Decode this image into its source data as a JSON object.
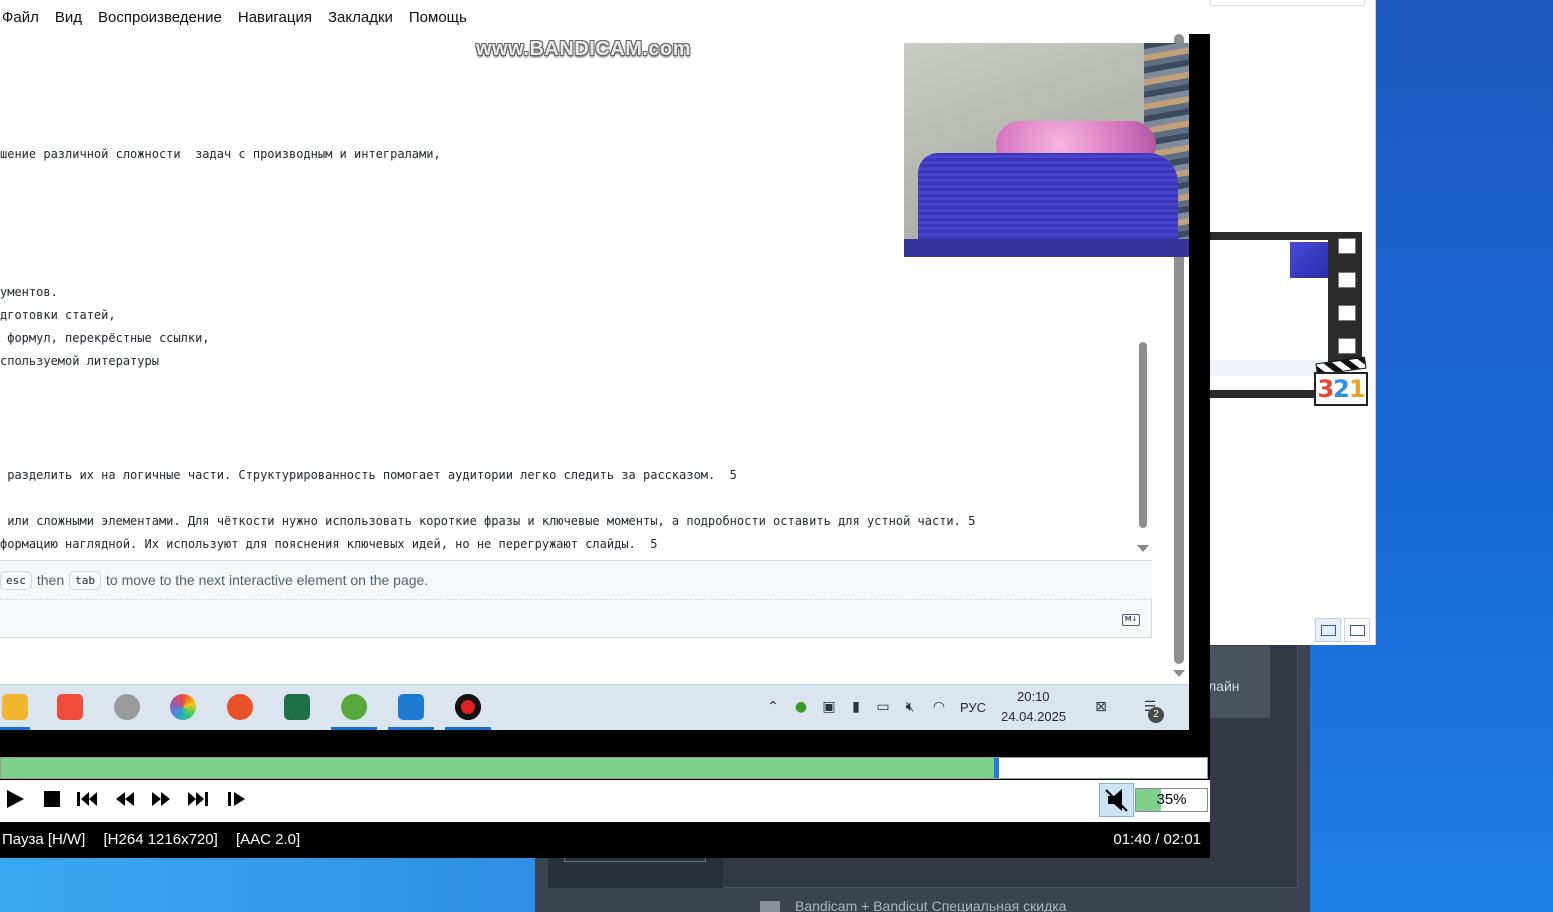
{
  "player": {
    "menu": [
      "Файл",
      "Вид",
      "Воспроизведение",
      "Навигация",
      "Закладки",
      "Помощь"
    ],
    "watermark": "www.BANDICAM.com",
    "seek_progress": 0.823,
    "volume_percent": "35%",
    "volume_level": 0.35,
    "status": {
      "state": "Пауза [H/W]",
      "video_codec": "[H264 1216x720]",
      "audio_codec": "[AAC 2.0]",
      "time": "01:40 / 02:01"
    },
    "icons": {
      "play": "play-icon",
      "stop": "stop-icon",
      "prev": "skip-previous-icon",
      "rewind": "rewind-icon",
      "forward": "fast-forward-icon",
      "next": "skip-next-icon",
      "frame_step": "frame-step-icon",
      "mute": "speaker-muted-icon"
    }
  },
  "video": {
    "editor_lines": [
      "шение различной сложности  задач с производным и интегралами,",
      "ументов.",
      "дготовки статей,",
      " формул, перекрёстные ссылки,",
      "спользуемой литературы",
      " разделить их на логичные части. Структурированность помогает аудитории легко следить за рассказом.  5",
      " или сложными элементами. Для чёткости нужно использовать короткие фразы и ключевые моменты, а подробности оставить для устной части. 5",
      "формацию наглядной. Их используют для пояснения ключевых идей, но не перегружают слайды.  5"
    ],
    "hint": {
      "key1": "esc",
      "then": "then",
      "key2": "tab",
      "rest": "to move to the next interactive element on the page."
    },
    "markdown_icon_label": "M↓",
    "taskbar": {
      "apps": [
        "file-explorer-icon",
        "anydesk-icon",
        "snipping-tool-icon",
        "chromium-icon",
        "wps-office-icon",
        "excel-icon",
        "utorrent-icon",
        "vscode-icon",
        "bandicam-record-icon"
      ],
      "language": "РУС",
      "clock_time": "20:10",
      "clock_date": "24.04.2025",
      "notification_count": "2"
    }
  },
  "background": {
    "bandicam_online_label": "лайн",
    "bandicam_footer": "Bandicam + Bandicut Специальная скидка",
    "mpc_logo_text": [
      "3",
      "2",
      "1"
    ]
  }
}
